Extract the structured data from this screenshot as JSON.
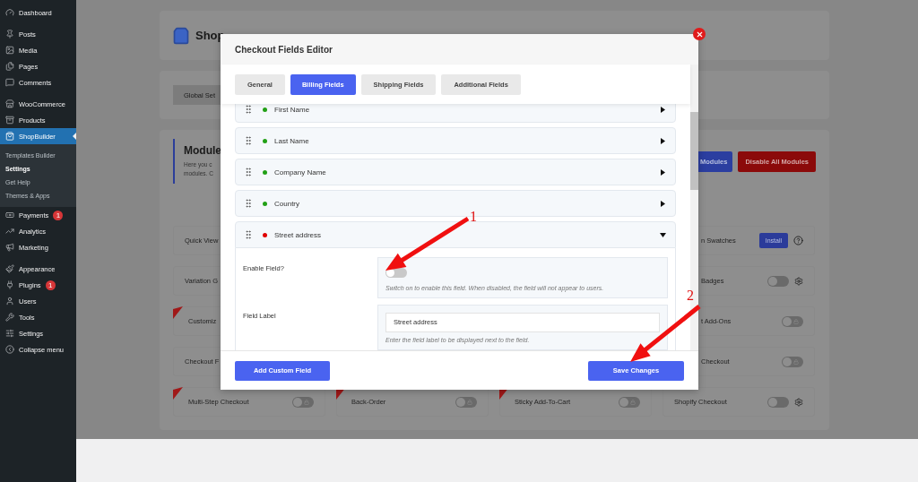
{
  "sidebar": {
    "groups": [
      [
        {
          "label": "Dashboard",
          "selected": false
        }
      ],
      [
        {
          "label": "Posts",
          "selected": false
        },
        {
          "label": "Media",
          "selected": false
        },
        {
          "label": "Pages",
          "selected": false
        },
        {
          "label": "Comments",
          "selected": false
        }
      ],
      [
        {
          "label": "WooCommerce",
          "selected": false
        },
        {
          "label": "Products",
          "selected": false
        },
        {
          "label": "ShopBuilder",
          "selected": true,
          "children": [
            {
              "label": "Templates Builder",
              "selected": false
            },
            {
              "label": "Settings",
              "selected": true
            },
            {
              "label": "Get Help",
              "selected": false
            },
            {
              "label": "Themes & Apps",
              "selected": false
            }
          ]
        },
        {
          "label": "Payments",
          "selected": false,
          "badge": "1"
        },
        {
          "label": "Analytics",
          "selected": false
        },
        {
          "label": "Marketing",
          "selected": false
        }
      ],
      [
        {
          "label": "Appearance",
          "selected": false
        },
        {
          "label": "Plugins",
          "selected": false,
          "badge": "1"
        },
        {
          "label": "Users",
          "selected": false
        },
        {
          "label": "Tools",
          "selected": false
        },
        {
          "label": "Settings",
          "selected": false
        },
        {
          "label": "Collapse menu",
          "selected": false
        }
      ]
    ]
  },
  "page": {
    "header": {
      "title": "Shop"
    },
    "settings_tab": "Global Set",
    "modules": {
      "title": "Module",
      "description": [
        "Here you c",
        "modules. C"
      ],
      "enable_button": "Modules",
      "disable_button": "Disable All Modules",
      "cards": [
        {
          "name": "Quick View",
          "pro": false
        },
        {
          "name": "n Swatches",
          "pro": false,
          "kind": "install",
          "button": "Install"
        },
        {
          "name": "Variation G",
          "pro": false
        },
        {
          "name": "Badges",
          "pro": false,
          "kind": "toggle",
          "on": false
        },
        {
          "name": "Customiz",
          "pro": true
        },
        {
          "name": "t Add-Ons",
          "pro": false,
          "kind": "locked",
          "on": false
        },
        {
          "name": "Checkout F",
          "pro": false
        },
        {
          "name": "Checkout",
          "pro": false,
          "kind": "locked",
          "on": false
        },
        {
          "name": "Multi-Step Checkout",
          "pro": true,
          "kind": "locked",
          "on": false
        },
        {
          "name": "Back-Order",
          "pro": true,
          "kind": "locked",
          "on": false
        },
        {
          "name": "Sticky Add-To-Cart",
          "pro": true,
          "kind": "locked",
          "on": false
        },
        {
          "name": "Shopify Checkout",
          "pro": false,
          "kind": "toggle",
          "on": false
        }
      ]
    }
  },
  "dialog": {
    "title": "Checkout Fields Editor",
    "tabs": [
      {
        "label": "General",
        "selected": false
      },
      {
        "label": "Billing Fields",
        "selected": true
      },
      {
        "label": "Shipping Fields",
        "selected": false
      },
      {
        "label": "Additional Fields",
        "selected": false
      }
    ],
    "fields": [
      {
        "label": "First Name",
        "color": "#22a016",
        "expanded": false
      },
      {
        "label": "Last Name",
        "color": "#22a016",
        "expanded": false
      },
      {
        "label": "Company Name",
        "color": "#22a016",
        "expanded": false
      },
      {
        "label": "Country",
        "color": "#22a016",
        "expanded": false
      },
      {
        "label": "Street address",
        "color": "#e00000",
        "expanded": true,
        "settings": [
          {
            "kind": "switch",
            "label": "Enable Field?",
            "on": false,
            "hint": "Switch on to enable this field. When disabled, the field will not appear to users."
          },
          {
            "kind": "text",
            "label": "Field Label",
            "value": "Street address",
            "hint": "Enter the field label to be displayed next to the field."
          }
        ]
      }
    ],
    "add_button": "Add Custom Field",
    "save_button": "Save Changes"
  },
  "annotations": [
    {
      "label": "1"
    },
    {
      "label": "2"
    }
  ]
}
